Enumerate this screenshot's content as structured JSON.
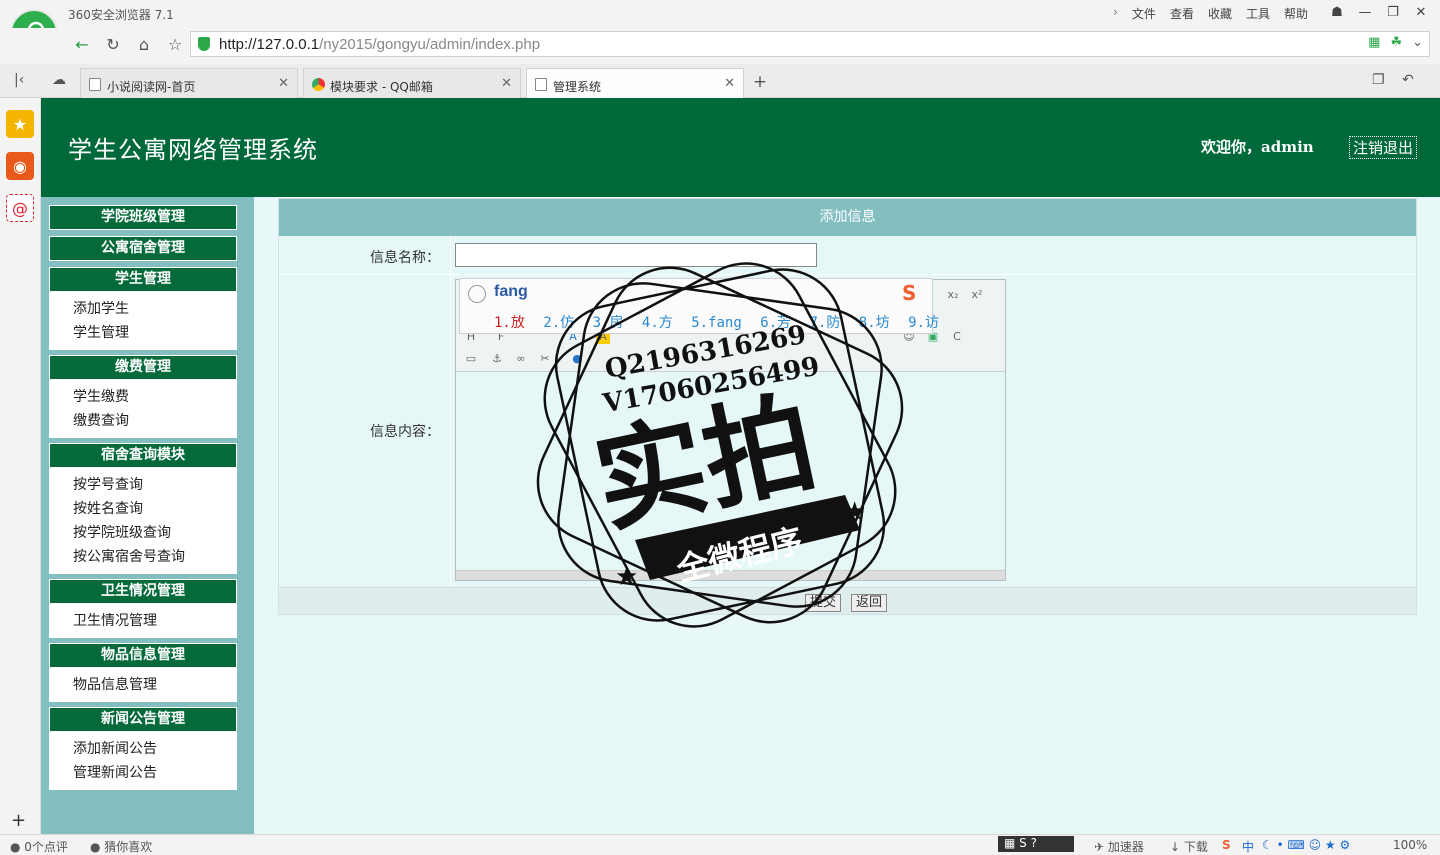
{
  "browser": {
    "name": "360安全浏览器 7.1",
    "menu": [
      "文件",
      "查看",
      "收藏",
      "工具",
      "帮助"
    ],
    "url_host": "http://127.0.0.1",
    "url_path": "/ny2015/gongyu/admin/index.php",
    "tabs": [
      {
        "title": "小说阅读网-首页",
        "icon": "page-icon",
        "active": false
      },
      {
        "title": "模块要求 - QQ邮箱",
        "icon": "chrome-icon",
        "active": false
      },
      {
        "title": "管理系统",
        "icon": "page-icon",
        "active": true
      }
    ],
    "zoom": "100%",
    "status": {
      "comments": "0个点评",
      "guess": "猜你喜欢",
      "accelerator": "加速器",
      "download": "下载",
      "ime_indicator": "中"
    }
  },
  "header": {
    "title": "学生公寓网络管理系统",
    "welcome": "欢迎你，admin",
    "logout": "注销退出"
  },
  "nav": [
    {
      "head": "学院班级管理",
      "items": []
    },
    {
      "head": "公寓宿舍管理",
      "items": []
    },
    {
      "head": "学生管理",
      "items": [
        "添加学生",
        "学生管理"
      ]
    },
    {
      "head": "缴费管理",
      "items": [
        "学生缴费",
        "缴费查询"
      ]
    },
    {
      "head": "宿舍查询模块",
      "items": [
        "按学号查询",
        "按姓名查询",
        "按学院班级查询",
        "按公寓宿舍号查询"
      ]
    },
    {
      "head": "卫生情况管理",
      "items": [
        "卫生情况管理"
      ]
    },
    {
      "head": "物品信息管理",
      "items": [
        "物品信息管理"
      ]
    },
    {
      "head": "新闻公告管理",
      "items": [
        "添加新闻公告",
        "管理新闻公告"
      ]
    }
  ],
  "form": {
    "title": "添加信息",
    "name_label": "信息名称：",
    "name_value": "",
    "content_label": "信息内容：",
    "submit": "提交",
    "back": "返回"
  },
  "ime": {
    "input": "fang",
    "candidates": [
      "1.放",
      "2.仿",
      "3.房",
      "4.方",
      "5.fang",
      "6.芳",
      "7.防",
      "8.坊",
      "9.访"
    ]
  },
  "watermark": {
    "line1": "Q2196316269",
    "line2": "V17060256499",
    "main": "实拍",
    "banner": "全微程序"
  }
}
